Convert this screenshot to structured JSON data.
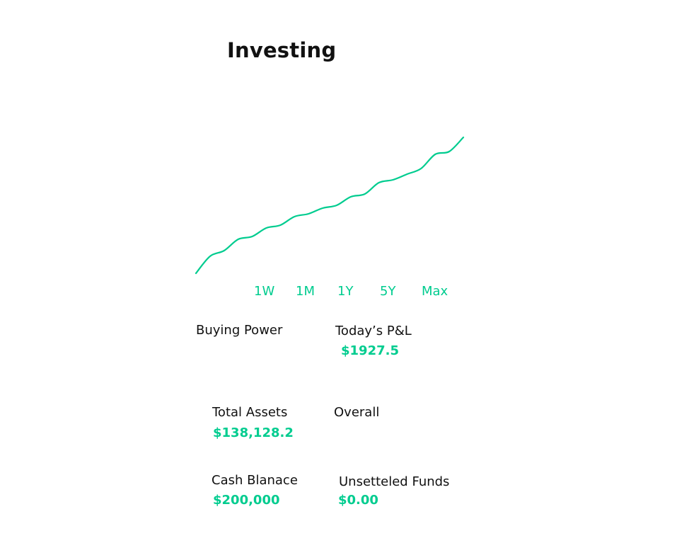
{
  "header": {
    "title": "Investing"
  },
  "colors": {
    "accent": "#00CC8F",
    "text": "#111111"
  },
  "chart_data": {
    "type": "line",
    "title": "",
    "xlabel": "",
    "ylabel": "",
    "series": [
      {
        "values": [
          0,
          6,
          8,
          12,
          13,
          16,
          17,
          20,
          21,
          23,
          24,
          27,
          28,
          32,
          33,
          35,
          37,
          42,
          43,
          48
        ]
      }
    ],
    "grid": false,
    "legend": "none"
  },
  "time_ranges": [
    {
      "label": "1W"
    },
    {
      "label": "1M"
    },
    {
      "label": "1Y"
    },
    {
      "label": "5Y"
    },
    {
      "label": "Max"
    }
  ],
  "stats": {
    "buying_power": {
      "label": "Buying Power",
      "value": ""
    },
    "todays_pl": {
      "label": "Today’s P&L",
      "value": "$1927.5"
    },
    "total_assets": {
      "label": "Total Assets",
      "value": "$138,128.2"
    },
    "overall": {
      "label": "Overall",
      "value": ""
    },
    "cash_balance": {
      "label": "Cash Blanace",
      "value": "$200,000"
    },
    "unsettled_funds": {
      "label": "Unsetteled Funds",
      "value": "$0.00"
    }
  }
}
